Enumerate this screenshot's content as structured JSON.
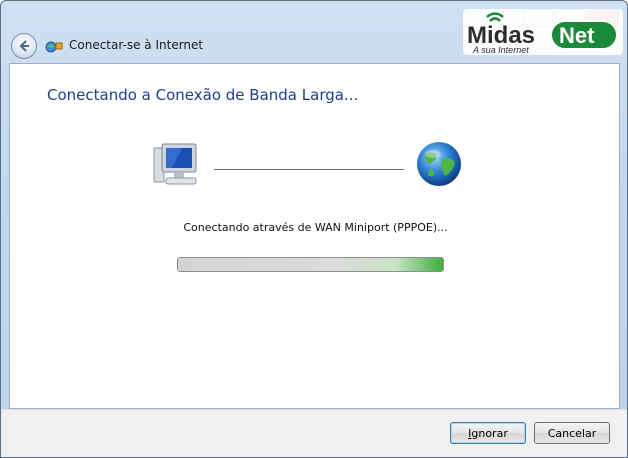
{
  "window": {
    "title": "Conectar-se à Internet"
  },
  "logo": {
    "brand_left": "Midas",
    "brand_right": "Net",
    "tagline": "A sua Internet"
  },
  "main": {
    "heading": "Conectando a Conexão de Banda Larga...",
    "status": "Conectando através de WAN Miniport (PPPOE)...",
    "progress_fraction": 0.0
  },
  "footer": {
    "ignore_label_first": "I",
    "ignore_label_rest": "gnorar",
    "cancel_label": "Cancelar"
  },
  "icons": {
    "back": "back-arrow-icon",
    "app": "network-connection-icon",
    "computer": "computer-icon",
    "globe": "globe-icon"
  },
  "colors": {
    "heading": "#1e3f8e",
    "progress_accent": "#3fae3c",
    "logo_green": "#1a8a3a"
  }
}
